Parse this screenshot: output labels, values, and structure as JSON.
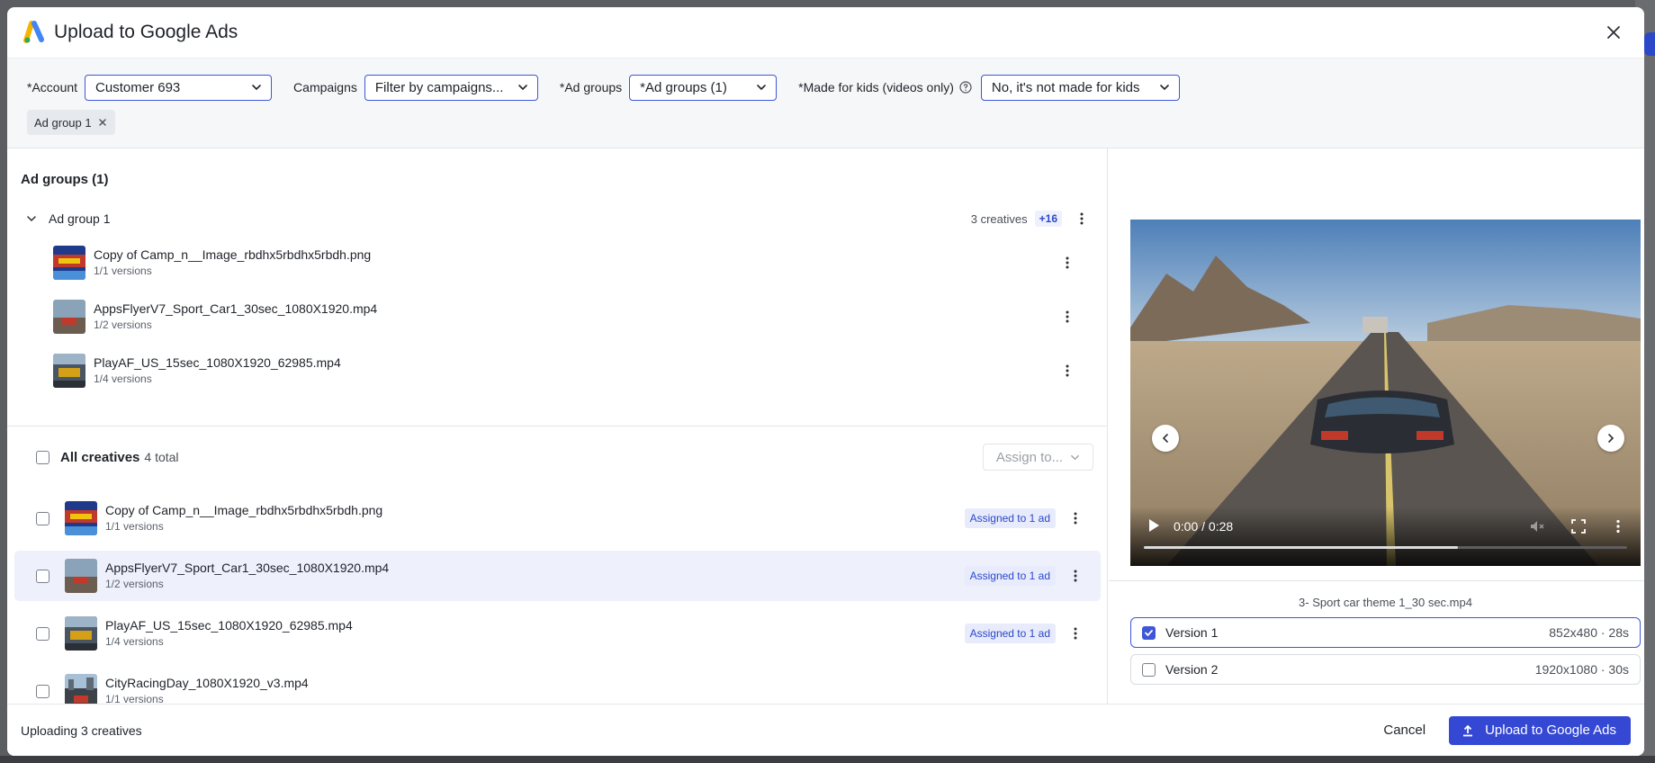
{
  "modal": {
    "title": "Upload to Google Ads"
  },
  "filters": {
    "account_label": "*Account",
    "account_value": "Customer 693",
    "campaigns_label": "Campaigns",
    "campaigns_value": "Filter by campaigns...",
    "adgroups_label": "*Ad groups",
    "adgroups_value": "*Ad groups (1)",
    "kids_label": "*Made for kids (videos only)",
    "kids_value": "No, it's not made for kids",
    "chips": [
      {
        "label": "Ad group 1"
      }
    ]
  },
  "groups_section": {
    "title": "Ad groups (1)",
    "group": {
      "name": "Ad group 1",
      "creative_count": "3 creatives",
      "plus_badge": "+16",
      "items": [
        {
          "name": "Copy of Camp_n__Image_rbdhx5rbdhx5rbdh.png",
          "versions": "1/1 versions"
        },
        {
          "name": "AppsFlyerV7_Sport_Car1_30sec_1080X1920.mp4",
          "versions": "1/2 versions"
        },
        {
          "name": "PlayAF_US_15sec_1080X1920_62985.mp4",
          "versions": "1/4 versions"
        }
      ]
    }
  },
  "all_creatives": {
    "title": "All creatives",
    "total": "4 total",
    "assign_label": "Assign to...",
    "rows": [
      {
        "name": "Copy of Camp_n__Image_rbdhx5rbdhx5rbdh.png",
        "versions": "1/1 versions",
        "status": "Assigned to 1 ad"
      },
      {
        "name": "AppsFlyerV7_Sport_Car1_30sec_1080X1920.mp4",
        "versions": "1/2 versions",
        "status": "Assigned to 1 ad"
      },
      {
        "name": "PlayAF_US_15sec_1080X1920_62985.mp4",
        "versions": "1/4 versions",
        "status": "Assigned to 1 ad"
      },
      {
        "name": "CityRacingDay_1080X1920_v3.mp4",
        "versions": "1/1 versions",
        "status": ""
      }
    ]
  },
  "preview": {
    "time": "0:00 / 0:28",
    "progress": 0.65,
    "file_name": "3- Sport car theme 1_30 sec.mp4",
    "versions": [
      {
        "label": "Version 1",
        "meta": "852x480 · 28s",
        "checked": true
      },
      {
        "label": "Version 2",
        "meta": "1920x1080 · 30s",
        "checked": false
      }
    ]
  },
  "footer": {
    "status": "Uploading 3 creatives",
    "cancel_label": "Cancel",
    "upload_label": "Upload to Google Ads"
  },
  "colors": {
    "accent": "#3548d4",
    "selected_row": "#eef0fb"
  }
}
